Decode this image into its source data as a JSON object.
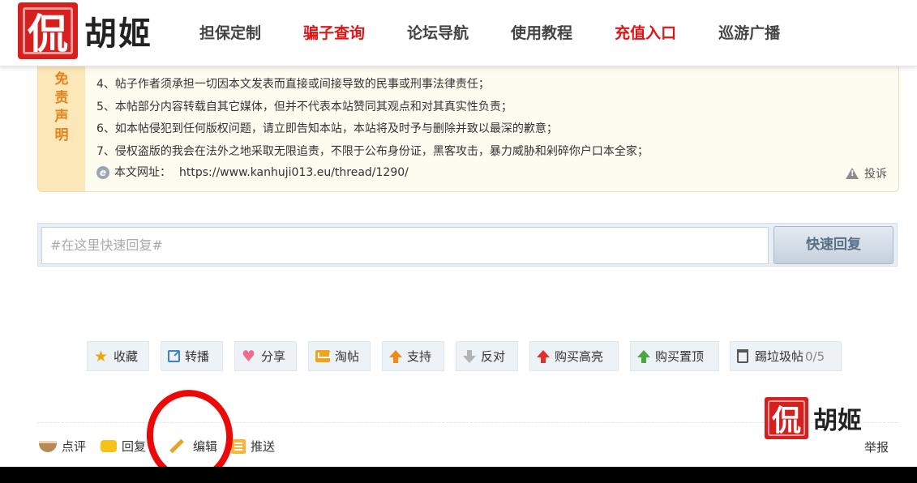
{
  "header": {
    "logo_seal": "侃",
    "logo_brand": "胡姬",
    "nav": [
      {
        "label": "担保定制",
        "color": "#444444"
      },
      {
        "label": "骗子查询",
        "color": "#e21414"
      },
      {
        "label": "论坛导航",
        "color": "#444444"
      },
      {
        "label": "使用教程",
        "color": "#444444"
      },
      {
        "label": "充值入口",
        "color": "#e21414"
      },
      {
        "label": "巡游广播",
        "color": "#444444"
      }
    ]
  },
  "disclaimer": {
    "tag": [
      "免",
      "责",
      "声",
      "明"
    ],
    "lines": [
      "4、帖子作者须承担一切因本文发表而直接或间接导致的民事或刑事法律责任；",
      "5、本帖部分内容转载自其它媒体，但并不代表本站赞同其观点和对其真实性负责；",
      "6、如本帖侵犯到任何版权问题，请立即告知本站，本站将及时予与删除并致以最深的歉意；",
      "7、侵权盗版的我会在法外之地采取无限追责，不限于公布身份证，黑客攻击，暴力威胁和剁碎你户口本全家；"
    ],
    "url_label": "本文网址：",
    "url": "https://www.kanhuji013.eu/thread/1290/",
    "complain_label": "投诉"
  },
  "quick_reply": {
    "placeholder": "#在这里快速回复#",
    "button": "快速回复"
  },
  "actions": {
    "favorite": "收藏",
    "repost": "转播",
    "share": "分享",
    "tao": "淘帖",
    "support": "支持",
    "oppose": "反对",
    "buy_highlight": "购买高亮",
    "buy_top": "购买置顶",
    "kick_trash": "踢垃圾帖",
    "kick_count": "0/5"
  },
  "footer": {
    "comment": "点评",
    "reply": "回复",
    "edit": "编辑",
    "push": "推送",
    "report": "举报",
    "logo_seal": "侃",
    "logo_brand": "胡姬"
  },
  "colors": {
    "accent_red": "#e21414",
    "disclaimer_tag": "#e5821b",
    "annotation_circle": "#ee0707"
  }
}
